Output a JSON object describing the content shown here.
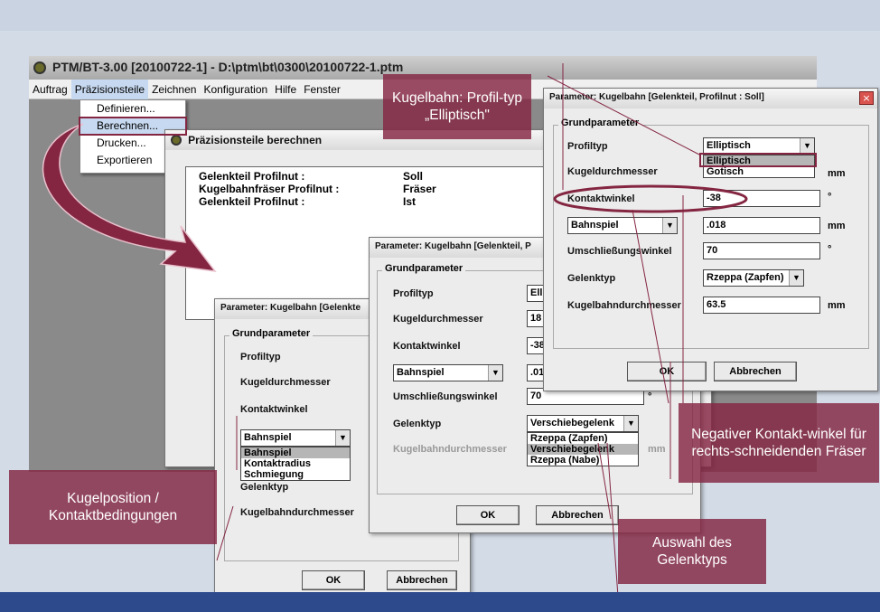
{
  "main_window": {
    "title": "PTM/BT-3.00 [20100722-1] - D:\\ptm\\bt\\0300\\20100722-1.ptm",
    "icon": "app-icon",
    "menu": [
      "Auftrag",
      "Präzisionsteile",
      "Zeichnen",
      "Konfiguration",
      "Hilfe",
      "Fenster"
    ],
    "dropdown": [
      "Definieren...",
      "Berechnen...",
      "Drucken...",
      "Exportieren"
    ]
  },
  "calc_window": {
    "title": "Präzisionsteile berechnen",
    "rows": [
      {
        "label": "Gelenkteil Profilnut :",
        "value": "Soll"
      },
      {
        "label": "Kugelbahnfräser Profilnut :",
        "value": "Fräser"
      },
      {
        "label": "Gelenkteil Profilnut :",
        "value": "Ist"
      }
    ]
  },
  "dialog_a": {
    "title": "Parameter: Kugelbahn [Gelenkte",
    "group": "Grundparameter",
    "labels": [
      "Profiltyp",
      "Kugeldurchmesser",
      "Kontaktwinkel",
      "Gelenktyp",
      "Kugelbahndurchmesser"
    ],
    "combo": "Bahnspiel",
    "combo_options": [
      "Bahnspiel",
      "Kontaktradius",
      "Schmiegung"
    ],
    "ok": "OK",
    "cancel": "Abbrechen"
  },
  "dialog_b": {
    "title": "Parameter: Kugelbahn [Gelenkteil, P",
    "group": "Grundparameter",
    "labels": [
      "Profiltyp",
      "Kugeldurchmesser",
      "Kontaktwinkel",
      "Umschließungswinkel",
      "Gelenktyp",
      "Kugelbahndurchmesser"
    ],
    "values": {
      "profiltyp": "Ell",
      "kugeldurchmesser": "18",
      "kontaktwinkel": "-38",
      "bahnspiel": ".01",
      "umschliessungswinkel": "70"
    },
    "combo": "Bahnspiel",
    "gelenktyp": "Verschiebegelenk",
    "gelenktyp_options": [
      "Rzeppa (Zapfen)",
      "Verschiebegelenk",
      "Rzeppa (Nabe)"
    ],
    "unit_mm": "mm",
    "unit_deg": "°",
    "ok": "OK",
    "cancel": "Abbrechen"
  },
  "dialog_c": {
    "title": "Parameter: Kugelbahn [Gelenkteil, Profilnut : Soll]",
    "group": "Grundparameter",
    "labels": [
      "Profiltyp",
      "Kugeldurchmesser",
      "Kontaktwinkel",
      "Umschließungswinkel",
      "Gelenktyp",
      "Kugelbahndurchmesser"
    ],
    "profiltyp": "Elliptisch",
    "profiltyp_options": [
      "Elliptisch",
      "Gotisch"
    ],
    "kontaktwinkel": "-38",
    "bahnspiel_combo": "Bahnspiel",
    "bahnspiel": ".018",
    "umschliessungswinkel": "70",
    "gelenktyp": "Rzeppa (Zapfen)",
    "kugelbahndurchmesser": "63.5",
    "unit_mm": "mm",
    "unit_deg": "°",
    "ok": "OK",
    "cancel": "Abbrechen",
    "close": "×"
  },
  "callouts": {
    "profiltyp": "Kugelbahn: Profil-typ „Elliptisch\"",
    "kontakt": "Negativer Kontakt-winkel für rechts-schneidenden Fräser",
    "gelenktyp": "Auswahl des Gelenktyps",
    "kugelpos": "Kugelposition / Kontaktbedingungen"
  },
  "colors": {
    "callout": "#842642",
    "background": "#d3dbe7",
    "bottom_band": "#2d4a8c"
  }
}
